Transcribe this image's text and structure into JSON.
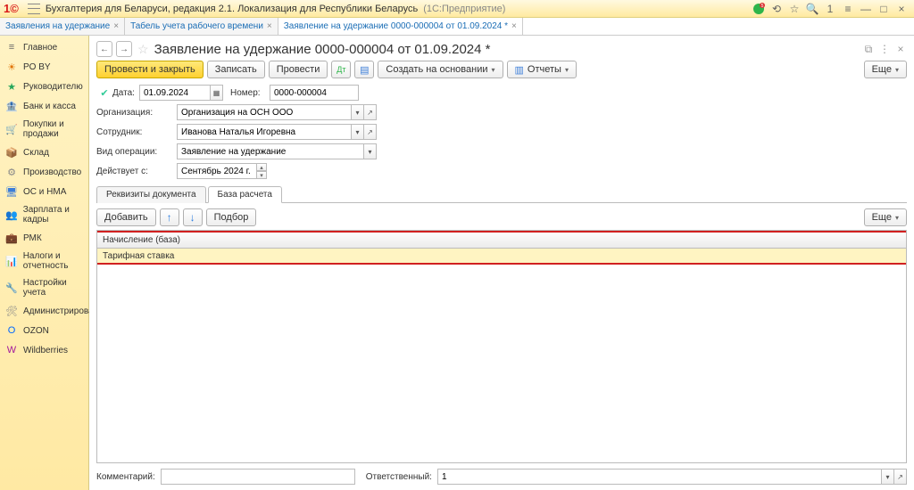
{
  "title": {
    "logo": "1©",
    "main": "Бухгалтерия для Беларуси, редакция 2.1. Локализация для Республики Беларусь",
    "sub": "(1С:Предприятие)",
    "search_num": "1"
  },
  "tabs": [
    {
      "label": "Заявления на удержание",
      "closable": true,
      "active": false
    },
    {
      "label": "Табель учета рабочего времени",
      "closable": true,
      "active": false
    },
    {
      "label": "Заявление на удержание 0000-000004 от 01.09.2024 *",
      "closable": true,
      "active": true
    }
  ],
  "sidebar": [
    {
      "icon": "≡",
      "color": "#666",
      "label": "Главное"
    },
    {
      "icon": "☀",
      "color": "#e07000",
      "label": "PO BY"
    },
    {
      "icon": "★",
      "color": "#26a65b",
      "label": "Руководителю"
    },
    {
      "icon": "🏦",
      "color": "#26a65b",
      "label": "Банк и касса"
    },
    {
      "icon": "🛒",
      "color": "#26a65b",
      "label": "Покупки и продажи"
    },
    {
      "icon": "📦",
      "color": "#b38f00",
      "label": "Склад"
    },
    {
      "icon": "⚙",
      "color": "#888",
      "label": "Производство"
    },
    {
      "icon": "🖥",
      "color": "#3b7dd8",
      "label": "ОС и НМА"
    },
    {
      "icon": "👥",
      "color": "#3b7dd8",
      "label": "Зарплата и кадры"
    },
    {
      "icon": "💼",
      "color": "#666",
      "label": "РМК"
    },
    {
      "icon": "📊",
      "color": "#26a65b",
      "label": "Налоги и отчетность"
    },
    {
      "icon": "🔧",
      "color": "#888",
      "label": "Настройки учета"
    },
    {
      "icon": "🛠",
      "color": "#888",
      "label": "Администрирование"
    },
    {
      "icon": "O",
      "color": "#0066ff",
      "label": "OZON"
    },
    {
      "icon": "W",
      "color": "#a3199c",
      "label": "Wildberries"
    }
  ],
  "doc": {
    "title": "Заявление на удержание 0000-000004 от 01.09.2024 *",
    "toolbar": {
      "post_close": "Провести и закрыть",
      "save": "Записать",
      "post": "Провести",
      "create_based": "Создать на основании",
      "reports": "Отчеты",
      "more": "Еще"
    },
    "fields": {
      "date_lbl": "Дата:",
      "date_val": "01.09.2024",
      "number_lbl": "Номер:",
      "number_val": "0000-000004",
      "org_lbl": "Организация:",
      "org_val": "Организация на ОСН ООО",
      "emp_lbl": "Сотрудник:",
      "emp_val": "Иванова Наталья Игоревна",
      "op_lbl": "Вид операции:",
      "op_val": "Заявление на удержание",
      "eff_lbl": "Действует с:",
      "eff_val": "Сентябрь 2024 г."
    },
    "tabs": {
      "tab1": "Реквизиты документа",
      "tab2": "База расчета"
    },
    "tool2": {
      "add": "Добавить",
      "pick": "Подбор",
      "more": "Еще"
    },
    "grid": {
      "header": "Начисление (база)",
      "row": "Тарифная ставка"
    },
    "footer": {
      "comment_lbl": "Комментарий:",
      "comment_val": "",
      "resp_lbl": "Ответственный:",
      "resp_val": "1"
    }
  }
}
